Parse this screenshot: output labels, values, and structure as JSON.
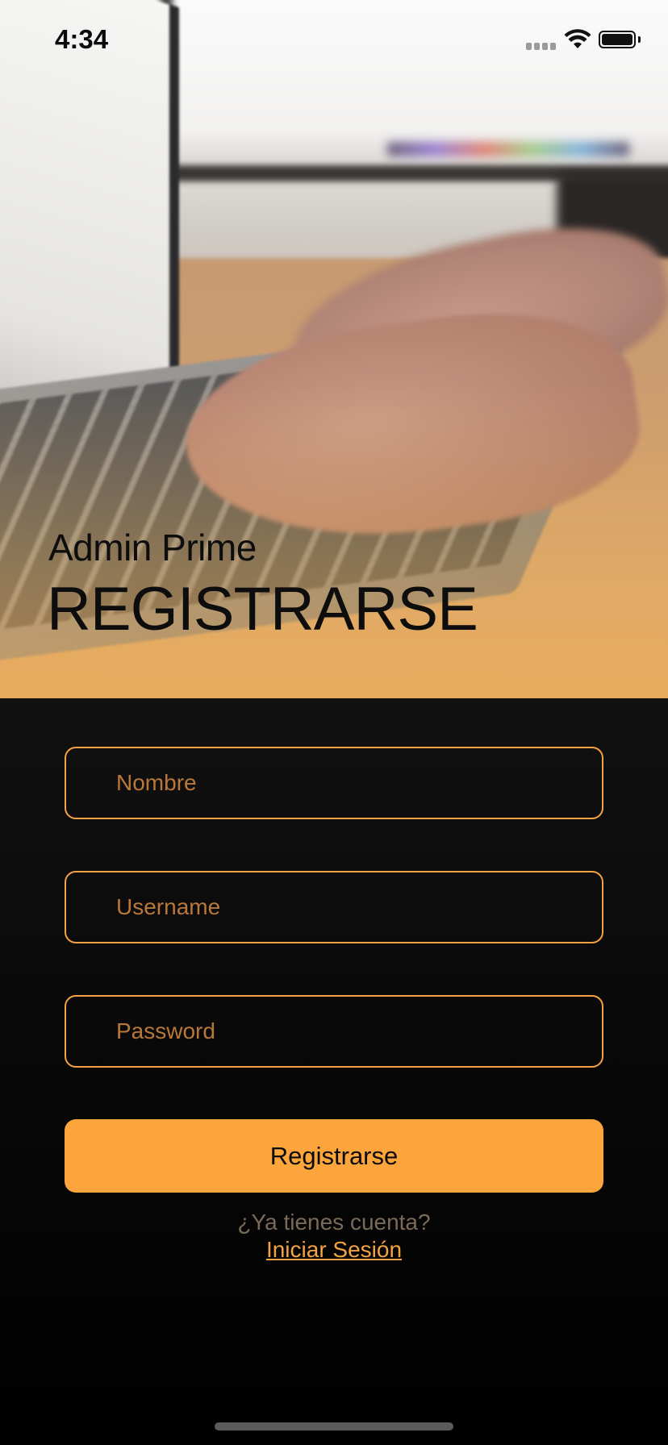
{
  "status_bar": {
    "time": "4:34"
  },
  "header": {
    "app_name": "Admin Prime",
    "title": "REGISTRARSE"
  },
  "form": {
    "fields": [
      {
        "placeholder": "Nombre",
        "value": ""
      },
      {
        "placeholder": "Username",
        "value": ""
      },
      {
        "placeholder": "Password",
        "value": ""
      }
    ],
    "submit_label": "Registrarse",
    "prompt": "¿Ya tienes cuenta?",
    "login_link": "Iniciar Sesión"
  },
  "colors": {
    "accent": "#fda53d",
    "field_border": "#f5a342",
    "background": "#0a0a0a"
  }
}
